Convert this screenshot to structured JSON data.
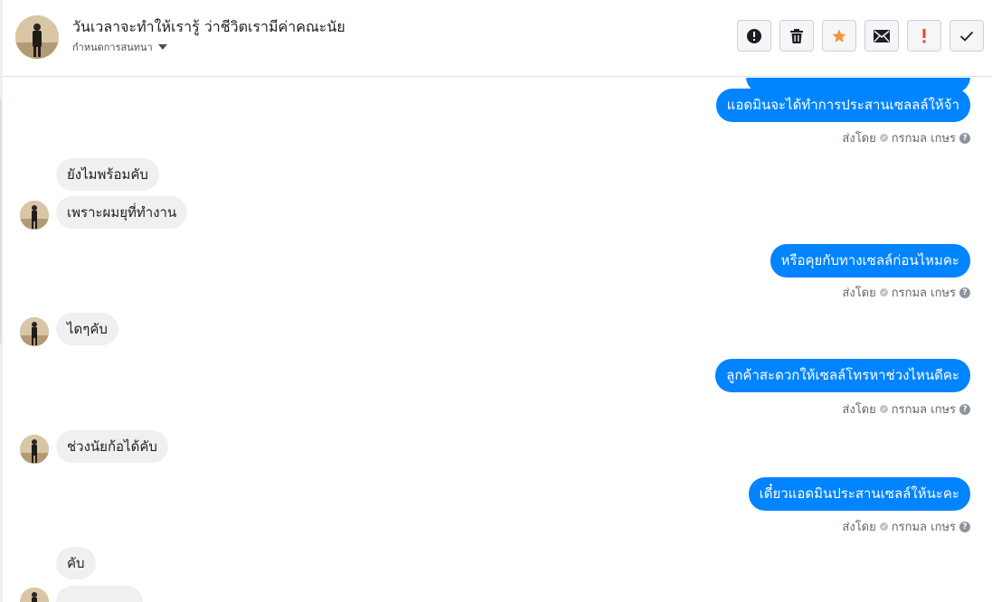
{
  "header": {
    "title": "วันเวลาจะทำให้เรารู้ ว่าชีวิตเรามีค่าคณะนัย",
    "subtitle": "กำหนดการสนทนา"
  },
  "toolbar": {
    "buttons": [
      {
        "name": "spam-button",
        "icon": "alert-circle-icon"
      },
      {
        "name": "delete-button",
        "icon": "trash-icon"
      },
      {
        "name": "star-button",
        "icon": "star-icon",
        "color": "#f7923b"
      },
      {
        "name": "mail-button",
        "icon": "envelope-icon"
      },
      {
        "name": "follow-up-button",
        "icon": "exclamation-icon",
        "color": "#e0452d"
      },
      {
        "name": "done-button",
        "icon": "check-icon"
      }
    ]
  },
  "messages": {
    "sent_by_label": "ส่งโดย",
    "agent_name": "กรกมล เกษร",
    "m1": "แอดมินจะได้ทำการประสานเซลลล์ให้จ้า",
    "m2": "ยังไมพร้อมคับ",
    "m3": "เพราะผมยุที่ทำงาน",
    "m4": "หรือคุยกับทางเซลล์ก่อนไหมคะ",
    "m5": "ไดๆคับ",
    "m6": "ลูกค้าสะดวกให้เซลล์โทรหาช่วงไหนดีคะ",
    "m7": "ช่วงนัยก้อได้คับ",
    "m8": "เดี๋ยวแอดมินประสานเซลล์ให้นะคะ",
    "m9": "คับ"
  },
  "colors": {
    "outgoing_bubble": "#0084ff",
    "incoming_bubble": "#f1f0f0"
  }
}
